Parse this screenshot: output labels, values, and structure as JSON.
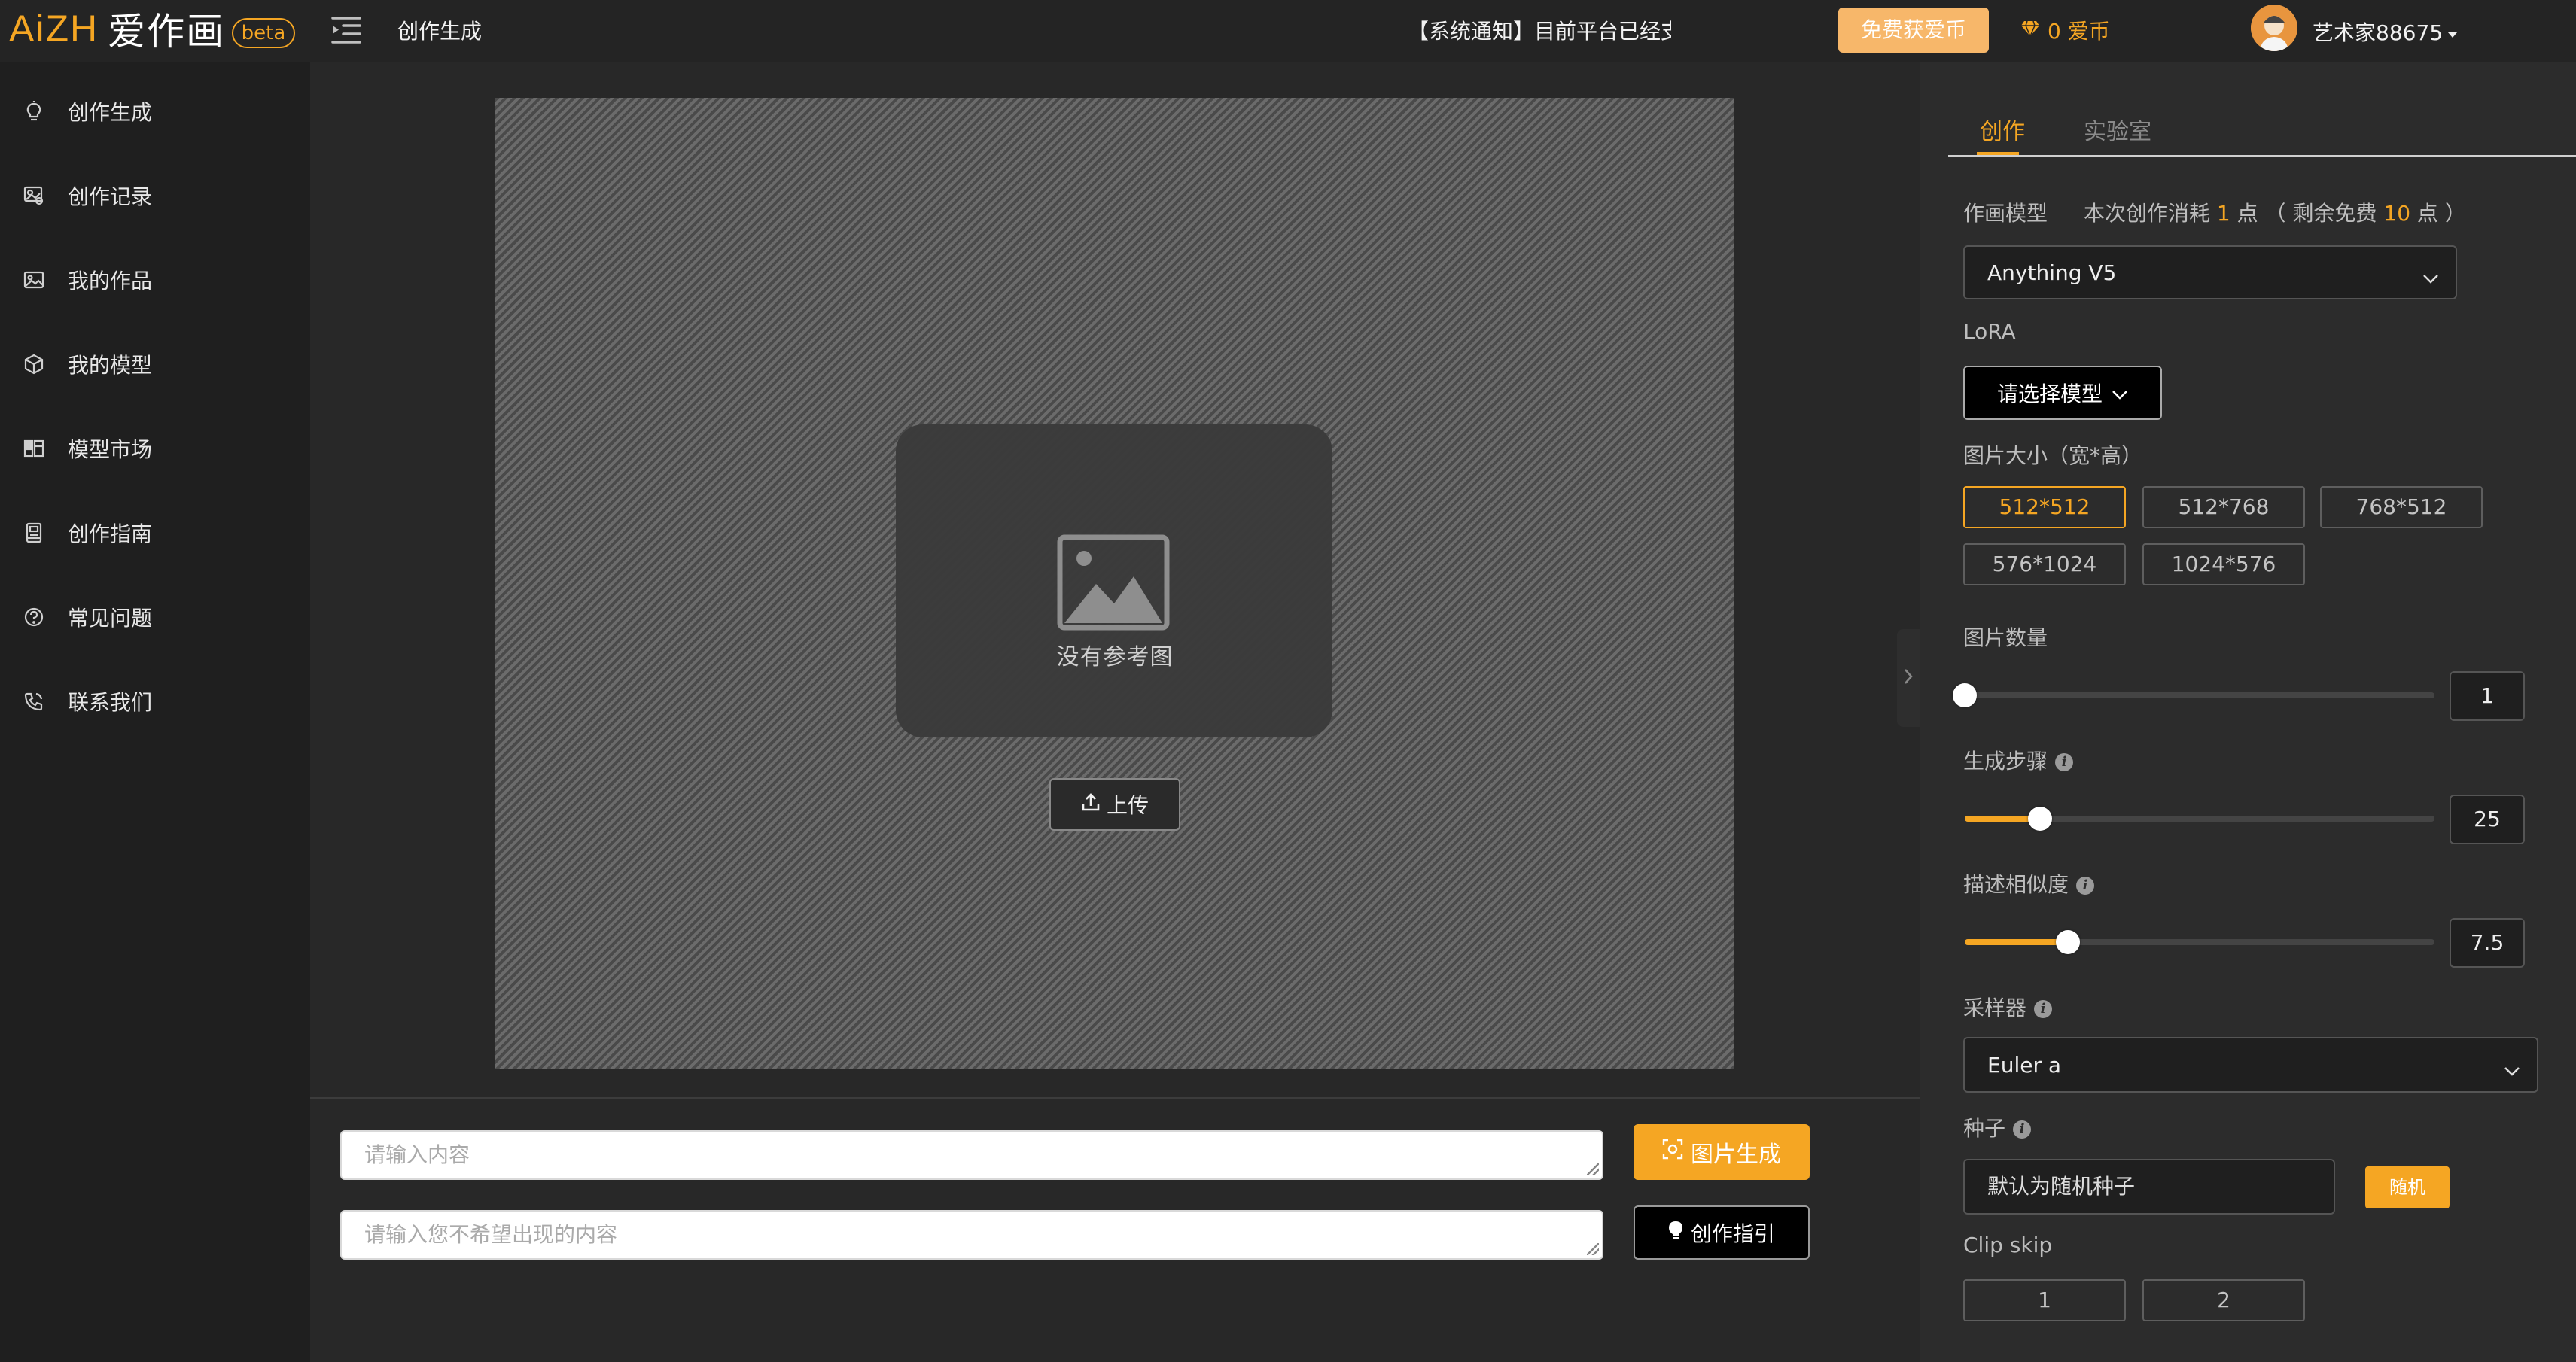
{
  "brand": {
    "logo_text": "AiZH",
    "logo_cn": "爱作画",
    "beta": "beta"
  },
  "topbar": {
    "title": "创作生成",
    "notice": "【系统通知】目前平台已经支",
    "free_coin_button": "免费获爱币",
    "coin_balance": "0 爱币",
    "username": "艺术家88675"
  },
  "sidebar": {
    "items": [
      {
        "label": "创作生成",
        "icon": "bulb-icon"
      },
      {
        "label": "创作记录",
        "icon": "record-icon"
      },
      {
        "label": "我的作品",
        "icon": "image-icon"
      },
      {
        "label": "我的模型",
        "icon": "cube-icon"
      },
      {
        "label": "模型市场",
        "icon": "market-icon"
      },
      {
        "label": "创作指南",
        "icon": "book-icon"
      },
      {
        "label": "常见问题",
        "icon": "question-icon"
      },
      {
        "label": "联系我们",
        "icon": "phone-icon"
      }
    ]
  },
  "canvas": {
    "placeholder_label": "没有参考图",
    "upload_label": "上传"
  },
  "prompt": {
    "positive_placeholder": "请输入内容",
    "negative_placeholder": "请输入您不希望出现的内容",
    "generate_label": "图片生成",
    "guide_label": "创作指引"
  },
  "panel": {
    "tabs": [
      "创作",
      "实验室"
    ],
    "model_label": "作画模型",
    "cost_prefix": "本次创作消耗",
    "cost_value": "1",
    "cost_unit": "点 （ 剩余免费",
    "remain_value": "10",
    "remain_unit": "点 ）",
    "model_value": "Anything V5",
    "lora_label": "LoRA",
    "lora_select": "请选择模型",
    "size_label": "图片大小（宽*高）",
    "sizes": [
      "512*512",
      "512*768",
      "768*512",
      "576*1024",
      "1024*576"
    ],
    "selected_size": "512*512",
    "count_label": "图片数量",
    "count_value": "1",
    "count_fraction": 0.0,
    "steps_label": "生成步骤",
    "steps_value": "25",
    "steps_fraction": 0.16,
    "cfg_label": "描述相似度",
    "cfg_value": "7.5",
    "cfg_fraction": 0.22,
    "sampler_label": "采样器",
    "sampler_value": "Euler a",
    "seed_label": "种子",
    "seed_placeholder": "默认为随机种子",
    "random_label": "随机",
    "clip_label": "Clip skip",
    "clip_options": [
      "1",
      "2"
    ]
  },
  "colors": {
    "accent": "#f5a623",
    "sidebar_bg": "#1f1f1f",
    "panel_bg": "#2c2c2c"
  }
}
